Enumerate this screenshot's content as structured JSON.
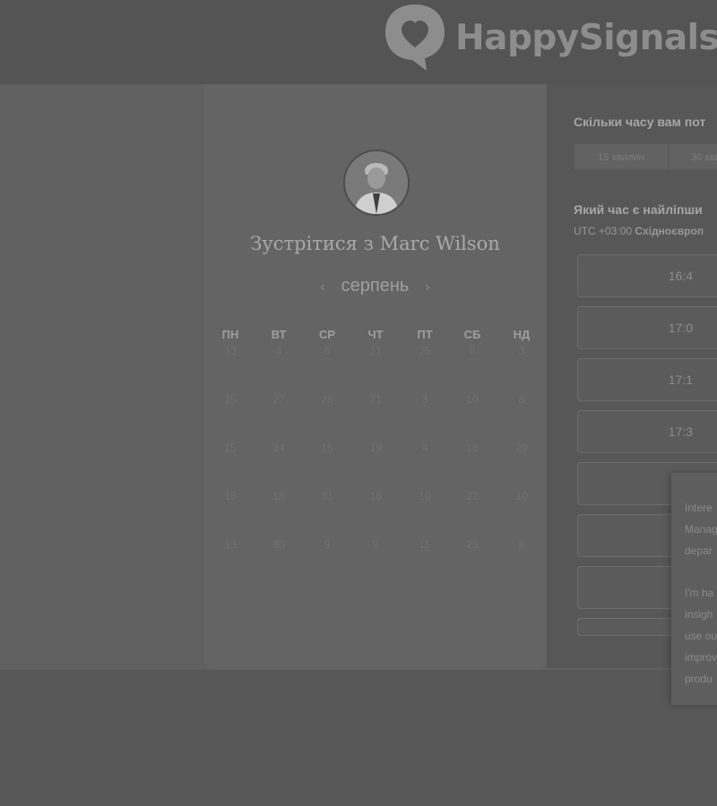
{
  "header": {
    "logo_text": "HappySignals",
    "logo_icon": "heart-speech-bubble-icon"
  },
  "booking": {
    "title": "Зустрітися з Marc Wilson",
    "avatar": "host-avatar-photo"
  },
  "calendar": {
    "month": "серпень",
    "prev_icon": "chevron-left-icon",
    "next_icon": "chevron-right-icon",
    "weekdays": [
      "ПН",
      "ВТ",
      "СР",
      "ЧТ",
      "ПТ",
      "СБ",
      "НД"
    ],
    "weeks": [
      [
        "13",
        "4",
        "6",
        "21",
        "25",
        "8",
        "3"
      ],
      [
        "25",
        "27",
        "26",
        "21",
        "3",
        "10",
        "8"
      ],
      [
        "15",
        "24",
        "15",
        "19",
        "4",
        "16",
        "29"
      ],
      [
        "18",
        "18",
        "31",
        "16",
        "10",
        "22",
        "10"
      ],
      [
        "13",
        "30",
        "9",
        "9",
        "11",
        "23",
        "8"
      ]
    ]
  },
  "time_panel": {
    "duration_question": "Скільки часу вам пот",
    "durations": [
      "15 хвилин",
      "30 хви"
    ],
    "time_question": "Який час є найліпши",
    "timezone_prefix": "UTC +03:00",
    "timezone_name": "Східноєвроп",
    "slots": [
      "16:4",
      "17:0",
      "17:1",
      "17:3",
      "",
      "",
      ""
    ]
  },
  "popup": {
    "lines": [
      "Intere",
      "Manag",
      "depar",
      "",
      "I'm ha",
      "insigh",
      "use ou",
      "improv",
      "produ"
    ]
  },
  "colors": {
    "overlay_bg": "#585858",
    "card_bg": "#646464",
    "panel_bg": "#575757"
  }
}
